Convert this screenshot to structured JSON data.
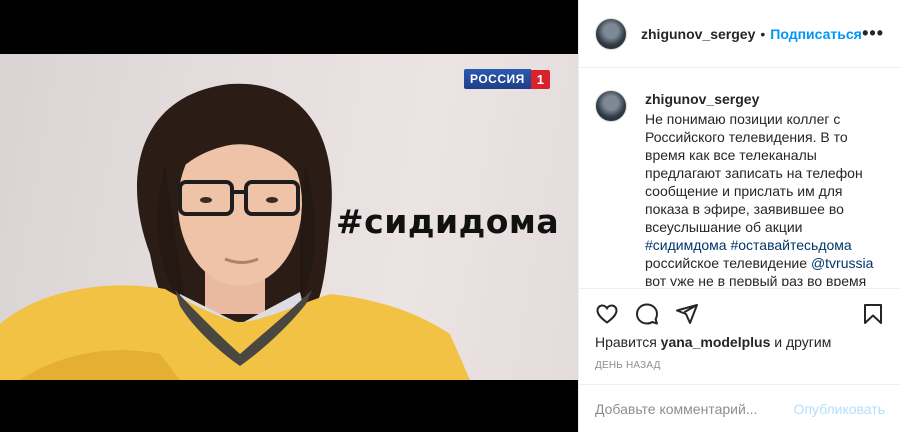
{
  "post": {
    "channel_logo": {
      "word": "РОССИЯ",
      "number": "1"
    },
    "overlay_text": "#сидидома"
  },
  "header": {
    "username": "zhigunov_sergey",
    "separator": "•",
    "follow_label": "Подписаться",
    "more_label": "•••"
  },
  "caption": {
    "username": "zhigunov_sergey",
    "text_1": "Не понимаю позиции коллег с Российского телевидения. В то время как все телеканалы предлагают записать на телефон сообщение и прислать им для показа в эфире, заявившее во всеуслышание об акции ",
    "tag_1": "#сидимдома",
    "tag_2": "#оставайтесьдома",
    "text_2": " российское телевидение ",
    "mention": "@tvrussia",
    "text_3": " вот уже не в первый раз во время"
  },
  "likes": {
    "prefix": "Нравится",
    "user": "yana_modelplus",
    "suffix": "и другим"
  },
  "time_label": "ДЕНЬ НАЗАД",
  "comment": {
    "placeholder": "Добавьте комментарий...",
    "publish_label": "Опубликовать"
  },
  "colors": {
    "accent": "#0095f6",
    "publish_disabled": "#b2dffc",
    "sweater": "#f2c244"
  },
  "icons": [
    "heart-icon",
    "comment-icon",
    "share-icon",
    "bookmark-icon",
    "more-icon"
  ]
}
